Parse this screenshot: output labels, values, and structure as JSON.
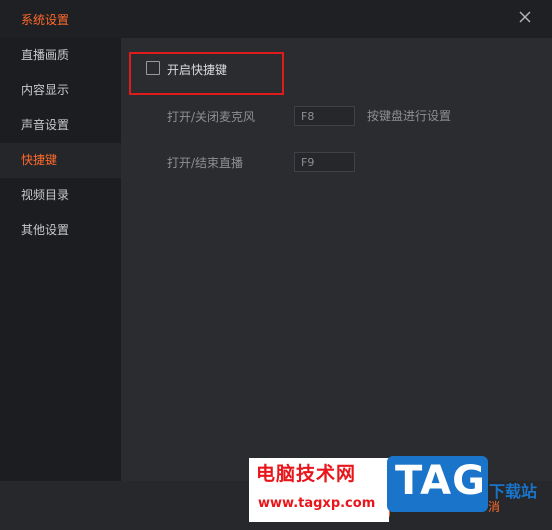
{
  "window": {
    "title": "系统设置"
  },
  "sidebar": {
    "items": [
      {
        "label": "直播画质"
      },
      {
        "label": "内容显示"
      },
      {
        "label": "声音设置"
      },
      {
        "label": "快捷键"
      },
      {
        "label": "视频目录"
      },
      {
        "label": "其他设置"
      }
    ],
    "active_index": 3
  },
  "hotkeys": {
    "enable_label": "开启快捷键",
    "enable_checked": false,
    "rows": [
      {
        "label": "打开/关闭麦克风",
        "value": "F8"
      },
      {
        "label": "打开/结束直播",
        "value": "F9"
      }
    ],
    "hint": "按键盘进行设置"
  },
  "watermark": {
    "cn": "电脑技术网",
    "url": "www.tagxp.com",
    "tag": "TAG",
    "side": "下载站"
  },
  "footer": {
    "cancel_label": "消"
  },
  "colors": {
    "accent": "#ff6a2a",
    "highlight_border": "#e01b1b"
  }
}
